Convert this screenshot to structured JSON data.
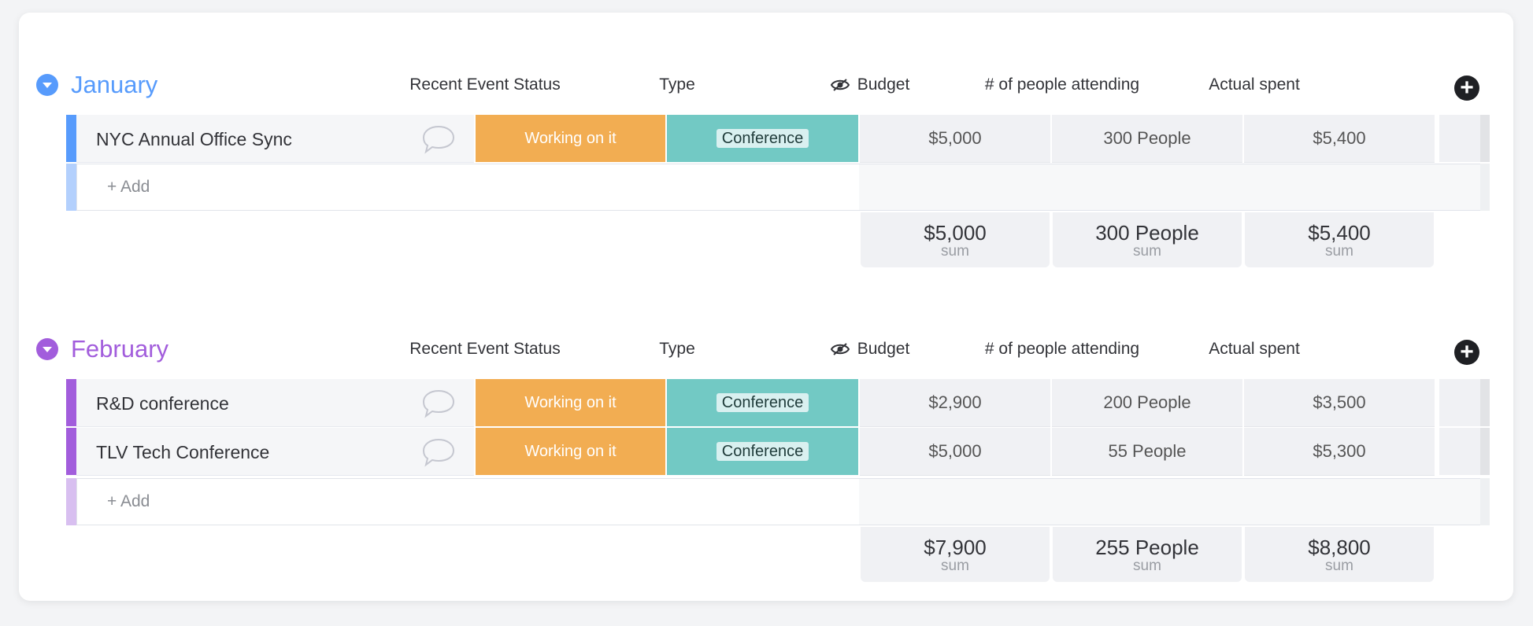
{
  "columns": {
    "status": "Recent Event Status",
    "type": "Type",
    "budget": "Budget",
    "attending": "# of people attending",
    "actual": "Actual spent",
    "budget_icon": "eye-icon",
    "add_column_icon": "plus-circle-icon"
  },
  "groups": [
    {
      "title": "January",
      "color": "#579bfc",
      "rows": [
        {
          "name": "NYC Annual Office Sync",
          "status": "Working on it",
          "type": "Conference",
          "budget": "$5,000",
          "attending": "300 People",
          "actual": "$5,400"
        }
      ],
      "add_label": "+ Add",
      "sums": {
        "budget": "$5,000",
        "attending": "300 People",
        "actual": "$5,400",
        "label": "sum"
      }
    },
    {
      "title": "February",
      "color": "#a25ddc",
      "rows": [
        {
          "name": "R&D conference",
          "status": "Working on it",
          "type": "Conference",
          "budget": "$2,900",
          "attending": "200 People",
          "actual": "$3,500"
        },
        {
          "name": "TLV Tech Conference",
          "status": "Working on it",
          "type": "Conference",
          "budget": "$5,000",
          "attending": "55 People",
          "actual": "$5,300"
        }
      ],
      "add_label": "+ Add",
      "sums": {
        "budget": "$7,900",
        "attending": "255 People",
        "actual": "$8,800",
        "label": "sum"
      }
    }
  ],
  "colors": {
    "status_working": "#f2ad52",
    "type_conference": "#72c9c4",
    "january_light": "#b3d0fd",
    "february_light": "#d8bff0"
  }
}
